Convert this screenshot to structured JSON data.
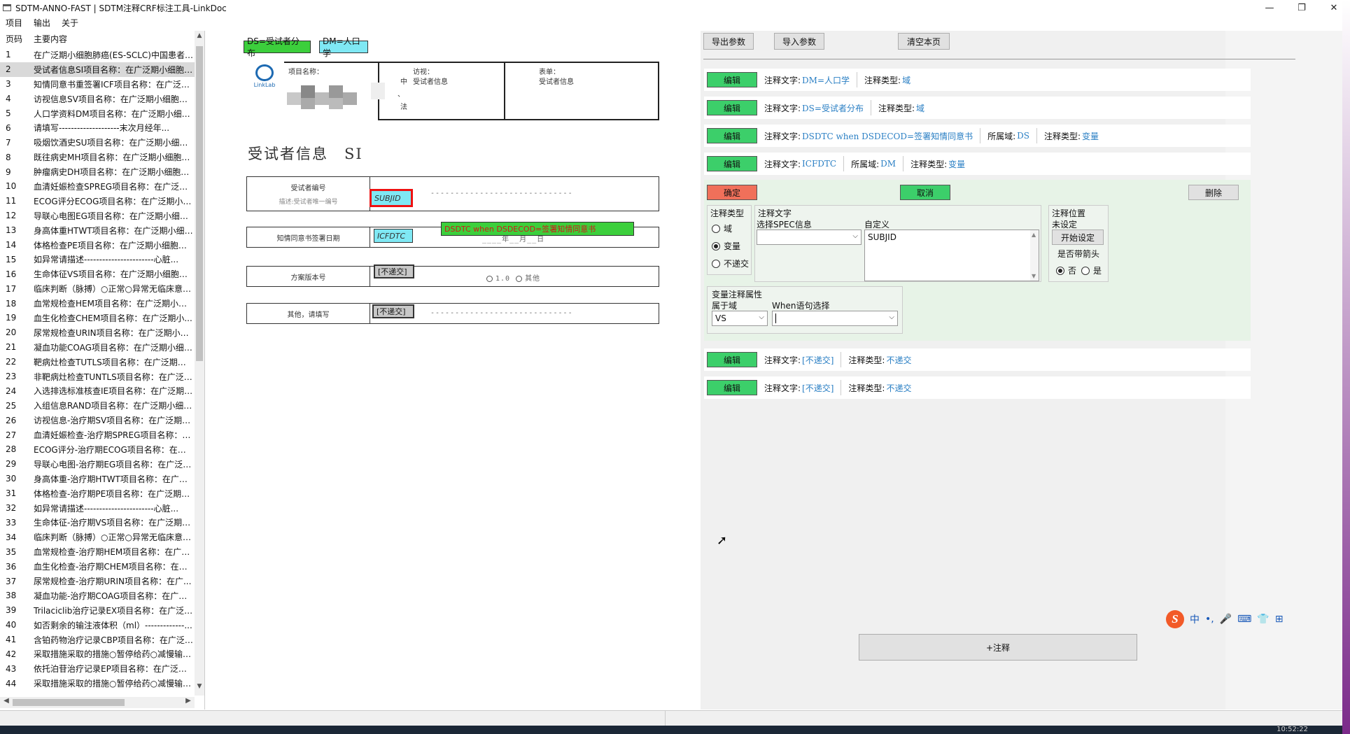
{
  "window": {
    "title": "SDTM-ANNO-FAST | SDTM注释CRF标注工具-LinkDoc",
    "minimize": "—",
    "maximize": "❐",
    "close": "✕"
  },
  "menu": [
    "项目",
    "输出",
    "关于"
  ],
  "list": {
    "headers": [
      "页码",
      "主要内容"
    ],
    "rows": [
      {
        "num": "1",
        "text": "在广泛期小细胞肺癌(ES-SCLC)中国患者中..."
      },
      {
        "num": "2",
        "text": "受试者信息SI项目名称：在广泛期小细胞肺..."
      },
      {
        "num": "3",
        "text": "知情同意书重签署ICF项目名称：在广泛期..."
      },
      {
        "num": "4",
        "text": "访视信息SV项目名称：在广泛期小细胞肺..."
      },
      {
        "num": "5",
        "text": "人口学资料DM项目名称：在广泛期小细胞..."
      },
      {
        "num": "6",
        "text": "请填写--------------------末次月经年..."
      },
      {
        "num": "7",
        "text": "吸烟饮酒史SU项目名称：在广泛期小细胞..."
      },
      {
        "num": "8",
        "text": "既往病史MH项目名称：在广泛期小细胞肺..."
      },
      {
        "num": "9",
        "text": "肿瘤病史DH项目名称：在广泛期小细胞肺..."
      },
      {
        "num": "10",
        "text": "血清妊娠检查SPREG项目名称：在广泛期..."
      },
      {
        "num": "11",
        "text": "ECOG评分ECOG项目名称：在广泛期小细..."
      },
      {
        "num": "12",
        "text": "导联心电图EG项目名称：在广泛期小细胞..."
      },
      {
        "num": "13",
        "text": "身高体重HTWT项目名称：在广泛期小细胞..."
      },
      {
        "num": "14",
        "text": "体格检查PE项目名称：在广泛期小细胞肺..."
      },
      {
        "num": "15",
        "text": "如异常请描述-----------------------心脏..."
      },
      {
        "num": "16",
        "text": "生命体征VS项目名称：在广泛期小细胞肺..."
      },
      {
        "num": "17",
        "text": "临床判断（脉搏）○正常○异常无临床意义..."
      },
      {
        "num": "18",
        "text": "血常规检查HEM项目名称：在广泛期小细..."
      },
      {
        "num": "19",
        "text": "血生化检查CHEM项目名称：在广泛期小..."
      },
      {
        "num": "20",
        "text": "尿常规检查URIN项目名称：在广泛期小细..."
      },
      {
        "num": "21",
        "text": "凝血功能COAG项目名称：在广泛期小细胞..."
      },
      {
        "num": "22",
        "text": "靶病灶检查TUTLS项目名称：在广泛期小..."
      },
      {
        "num": "23",
        "text": "非靶病灶检查TUNTLS项目名称：在广泛期..."
      },
      {
        "num": "24",
        "text": "入选排选标准核查IE项目名称：在广泛期小..."
      },
      {
        "num": "25",
        "text": "入组信息RAND项目名称：在广泛期小细胞..."
      },
      {
        "num": "26",
        "text": "访视信息-治疗期SV项目名称：在广泛期小..."
      },
      {
        "num": "27",
        "text": "血清妊娠检查-治疗期SPREG项目名称：在..."
      },
      {
        "num": "28",
        "text": "ECOG评分-治疗期ECOG项目名称：在广..."
      },
      {
        "num": "29",
        "text": "导联心电图-治疗期EG项目名称：在广泛期..."
      },
      {
        "num": "30",
        "text": "身高体重-治疗期HTWT项目名称：在广泛..."
      },
      {
        "num": "31",
        "text": "体格检查-治疗期PE项目名称：在广泛期小..."
      },
      {
        "num": "32",
        "text": "如异常请描述-----------------------心脏..."
      },
      {
        "num": "33",
        "text": "生命体征-治疗期VS项目名称：在广泛期小..."
      },
      {
        "num": "34",
        "text": "临床判断（脉搏）○正常○异常无临床意义..."
      },
      {
        "num": "35",
        "text": "血常规检查-治疗期HEM项目名称：在广泛..."
      },
      {
        "num": "36",
        "text": "血生化检查-治疗期CHEM项目名称：在广..."
      },
      {
        "num": "37",
        "text": "尿常规检查-治疗期URIN项目名称：在广..."
      },
      {
        "num": "38",
        "text": "凝血功能-治疗期COAG项目名称：在广泛..."
      },
      {
        "num": "39",
        "text": "Trilaciclib治疗记录EX项目名称：在广泛期..."
      },
      {
        "num": "40",
        "text": "如否剩余的输注液体积（ml）-------------..."
      },
      {
        "num": "41",
        "text": "含铂药物治疗记录CBP项目名称：在广泛期..."
      },
      {
        "num": "42",
        "text": "采取措施采取的措施○暂停给药○减慢输注..."
      },
      {
        "num": "43",
        "text": "依托泊苷治疗记录EP项目名称：在广泛期..."
      },
      {
        "num": "44",
        "text": "采取措施采取的措施○暂停给药○减慢输注..."
      }
    ],
    "selected_row": "2"
  },
  "crf": {
    "tag_ds": "DS=受试者分布",
    "tag_dm": "DM=人口学",
    "logo_text": "LinkLab",
    "hdr_project": "项目名称：",
    "hdr_visit_label": "访视：",
    "hdr_visit_value": "受试者信息",
    "hdr_form_label": "表单：",
    "hdr_form_value": "受试者信息",
    "hdr_frag1": "中",
    "hdr_frag2": "、",
    "hdr_frag3": "法",
    "section_title": "受试者信息　SI",
    "row1_label": "受试者编号",
    "row1_sub": "描述:受试者唯一编号",
    "row1_dash": "-----------------------------",
    "row2_label": "知情同意书签署日期",
    "row2_dash": "____年__月__日",
    "row3_label": "方案版本号",
    "row3_opt1": "1.0",
    "row3_opt2": "其他",
    "row4_label": "其他，请填写",
    "row4_dash": "-----------------------------",
    "ann_subjid": "SUBJID",
    "ann_icfdtc": "ICFDTC",
    "ann_dsdtc": "DSDTC when DSDECOD=签署知情同意书",
    "ann_nd1": "[不递交]",
    "ann_nd2": "[不递交]"
  },
  "right": {
    "export_btn": "导出参数",
    "import_btn": "导入参数",
    "clear_btn": "清空本页",
    "edit_label": "编辑",
    "annotations": [
      {
        "text_label": "注释文字:",
        "text": "DM=人口学",
        "type_label": "注释类型:",
        "type": "域"
      },
      {
        "text_label": "注释文字:",
        "text": "DS=受试者分布",
        "type_label": "注释类型:",
        "type": "域"
      },
      {
        "text_label": "注释文字:",
        "text": "DSDTC when DSDECOD=签署知情同意书",
        "domain_label": "所属域:",
        "domain": "DS",
        "type_label": "注释类型:",
        "type": "变量"
      },
      {
        "text_label": "注释文字:",
        "text": "ICFDTC",
        "domain_label": "所属域:",
        "domain": "DM",
        "type_label": "注释类型:",
        "type": "变量"
      }
    ],
    "editor": {
      "ok": "确定",
      "cancel": "取消",
      "delete": "删除",
      "type_group": "注释类型",
      "type_opts": [
        "域",
        "变量",
        "不递交"
      ],
      "text_group": "注释文字",
      "spec_label": "选择SPEC信息",
      "spec_value": "",
      "custom_label": "自定义",
      "custom_value": "SUBJID",
      "pos_group": "注释位置",
      "pos_status": "未设定",
      "pos_btn": "开始设定",
      "arrow_label": "是否带箭头",
      "arrow_no": "否",
      "arrow_yes": "是",
      "var_group": "变量注释属性",
      "domain_label": "属于域",
      "domain_value": "VS",
      "when_label": "When语句选择",
      "when_value": ""
    },
    "annotations_after": [
      {
        "text_label": "注释文字:",
        "text": "[不递交]",
        "type_label": "注释类型:",
        "type": "不递交"
      },
      {
        "text_label": "注释文字:",
        "text": "[不递交]",
        "type_label": "注释类型:",
        "type": "不递交"
      }
    ],
    "add_btn": "+注释"
  },
  "ime": {
    "logo": "S",
    "items": [
      "中",
      "•,",
      "🎤",
      "⌨",
      "👕",
      "⊞"
    ]
  },
  "taskbar": {
    "clock": "10:52:22"
  }
}
